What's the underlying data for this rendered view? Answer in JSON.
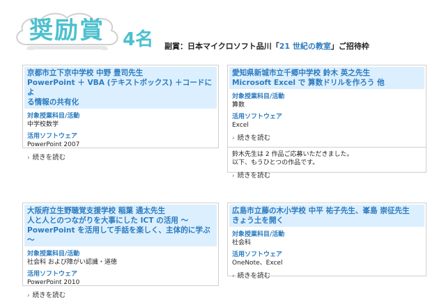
{
  "header": {
    "award_title": "奨励賞",
    "count": "4名",
    "subprize_prefix": "副賞：日本マイクロソフト品川「",
    "subprize_highlight": "21 世紀の教室",
    "subprize_suffix": "」ご招待枠"
  },
  "labels": {
    "subject": "対象授業科目/活動",
    "software": "活用ソフトウェア",
    "read_more": "続きを読む"
  },
  "cards": [
    {
      "title_lines": [
        "京都市立下京中学校 中野 豊司先生",
        "PowerPoint ＋ VBA (テキストボックス) ＋コードによ",
        "る情報の共有化"
      ],
      "subject": "中学校数学",
      "software": "PowerPoint 2007"
    },
    {
      "title_lines": [
        "愛知県新城市立千郷中学校 鈴木 英之先生",
        "Microsoft Excel で 算数ドリルを作ろう 他"
      ],
      "subject": "算数",
      "software": "Excel",
      "note_lines": [
        "鈴木先生は 2 作品ご応募いただきました。",
        "以下、もうひとつの作品です。"
      ]
    },
    {
      "title_lines": [
        "大阪府立生野聴覚支援学校 稲葉 通太先生",
        "人と人とのつながりを大事にした ICT の活用 〜",
        "PowerPoint を活用して手話を楽しく、主体的に学ぶ 〜"
      ],
      "subject": "社会科 および障がい認識・道徳",
      "software": "PowerPoint 2010"
    },
    {
      "title_lines": [
        "広島市立藤の木小学校 中平 祐子先生、峯島 崇征先生",
        "きょう土を開く"
      ],
      "subject": "社会科",
      "software": "OneNote、Excel"
    }
  ]
}
